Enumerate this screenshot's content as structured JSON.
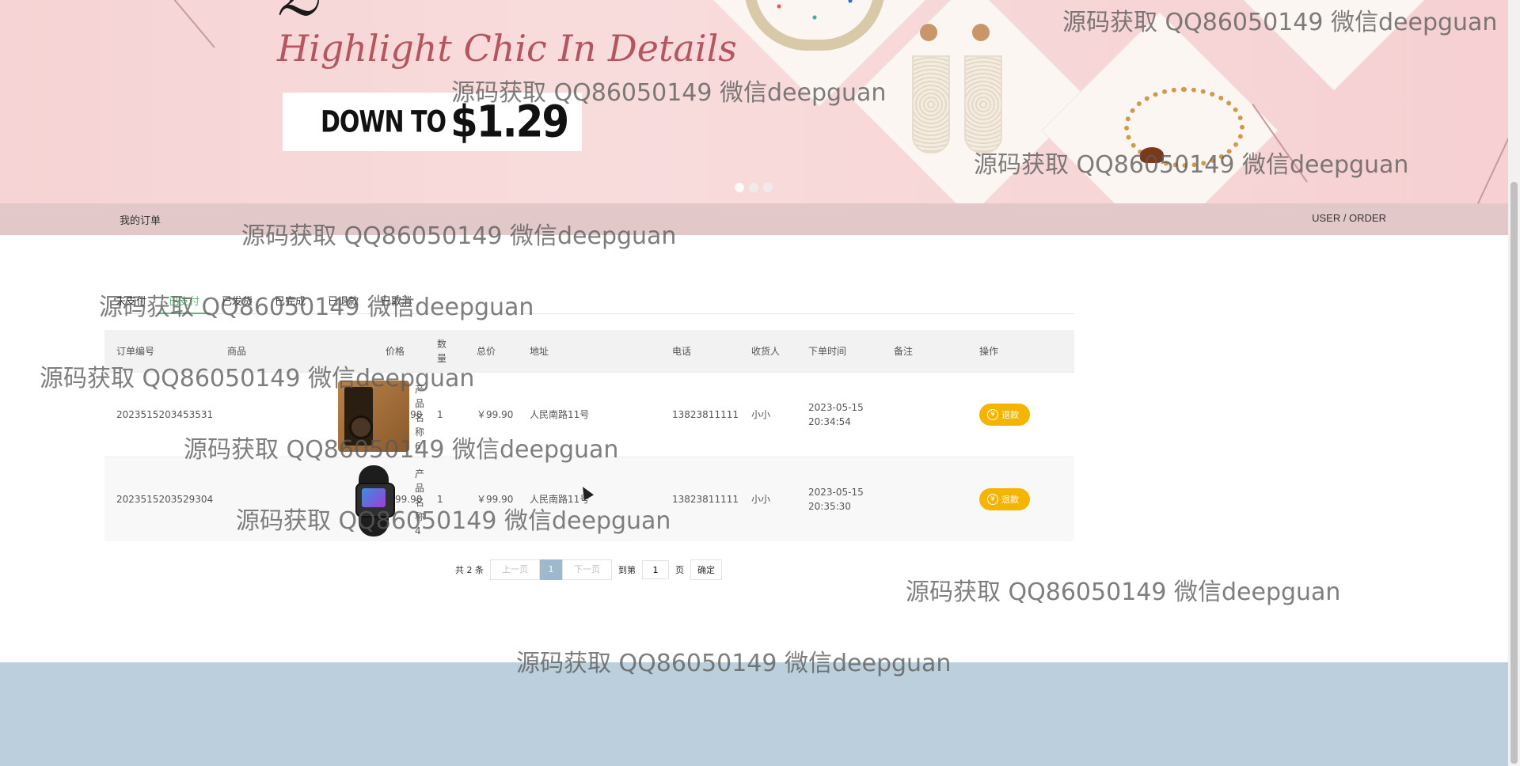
{
  "banner": {
    "slogan": "Highlight Chic In Details",
    "price_prefix": "DOWN TO",
    "price": "$1.29"
  },
  "titlebar": {
    "left": "我的订单",
    "right": "USER / ORDER"
  },
  "tabs": [
    {
      "label": "未支付",
      "active": false
    },
    {
      "label": "已支付",
      "active": true
    },
    {
      "label": "已发货",
      "active": false
    },
    {
      "label": "已完成",
      "active": false
    },
    {
      "label": "已退款",
      "active": false
    },
    {
      "label": "已取消",
      "active": false
    }
  ],
  "table": {
    "headers": [
      "订单编号",
      "商品",
      "价格",
      "数量",
      "总价",
      "地址",
      "电话",
      "收货人",
      "下单时间",
      "备注",
      "操作"
    ],
    "rows": [
      {
        "order_no": "2023515203453531",
        "product_name": "产品名称6",
        "price": "￥99.90",
        "qty": "1",
        "total": "￥99.90",
        "address": "人民南路11号",
        "phone": "13823811111",
        "receiver": "小小",
        "date": "2023-05-15",
        "time": "20:34:54",
        "note": "",
        "action": "退款"
      },
      {
        "order_no": "2023515203529304",
        "product_name": "产品名称4",
        "price": "￥99.90",
        "qty": "1",
        "total": "￥99.90",
        "address": "人民南路11号",
        "phone": "13823811111",
        "receiver": "小小",
        "date": "2023-05-15",
        "time": "20:35:30",
        "note": "",
        "action": "退款"
      }
    ]
  },
  "pager": {
    "count": "共 2 条",
    "prev": "上一页",
    "current": "1",
    "next": "下一页",
    "goto": "到第",
    "goto_value": "1",
    "unit": "页",
    "confirm": "确定"
  },
  "watermark": "源码获取 QQ86050149 微信deepguan",
  "colors": {
    "accent": "#5fb878",
    "refund": "#f5b400",
    "titlebar": "#e3c8c9",
    "footer": "#bccfdd",
    "pager_current": "#a0b8cc"
  }
}
